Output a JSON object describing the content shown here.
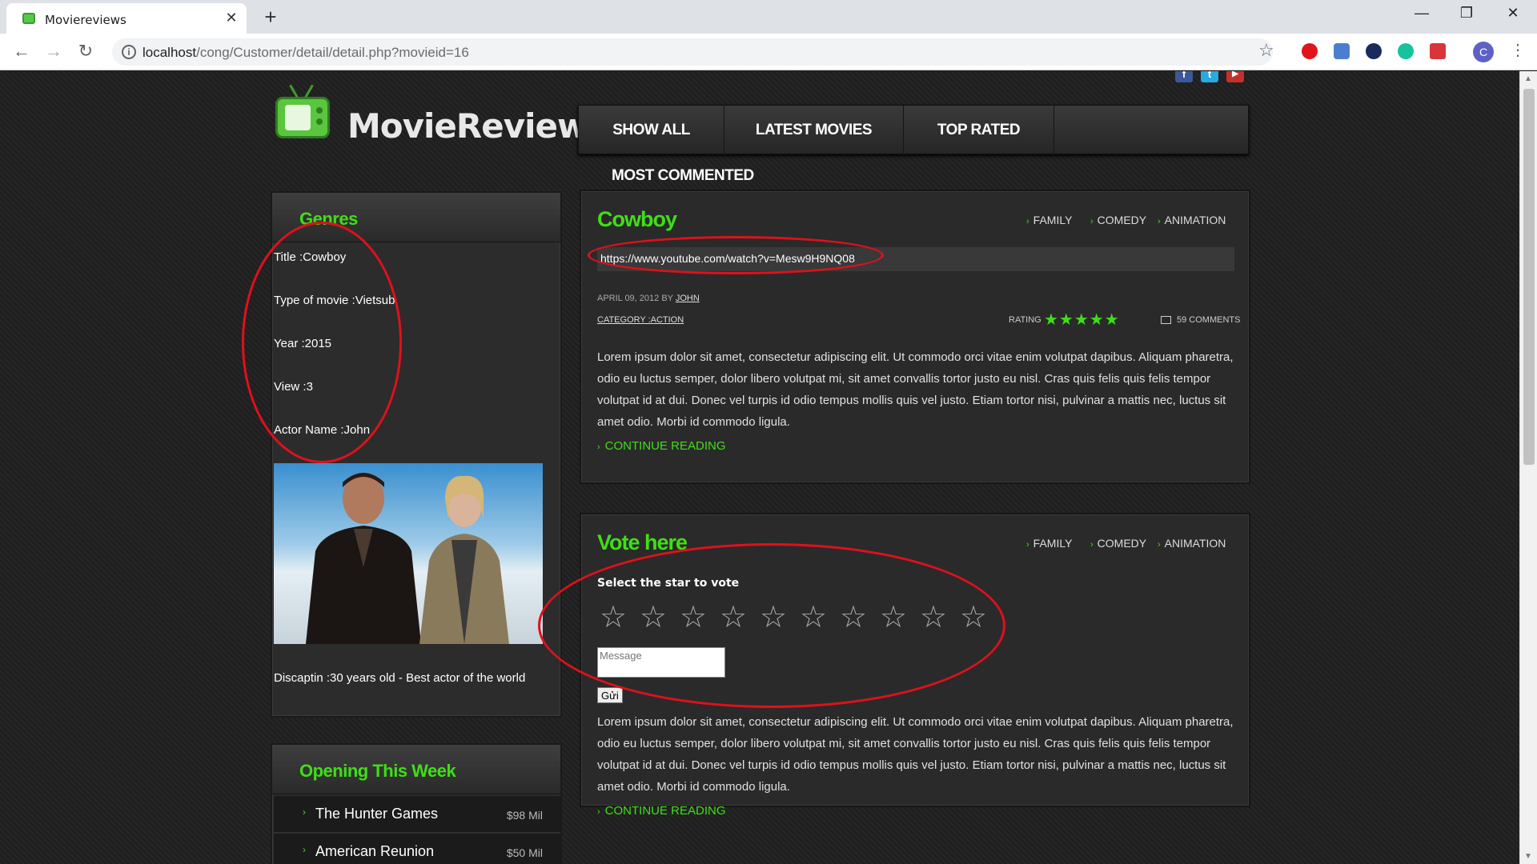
{
  "browser": {
    "tab_title": "Moviereviews",
    "tab_close": "✕",
    "new_tab": "+",
    "url_host": "localhost",
    "url_path": "/cong/Customer/detail/detail.php?movieid=16",
    "profile_initial": "C",
    "window_controls": [
      "—",
      "❐",
      "✕"
    ]
  },
  "site": {
    "logo_text": "MovieReviews",
    "nav": [
      "SHOW ALL",
      "LATEST MOVIES",
      "TOP RATED"
    ],
    "nav_second_row": "MOST COMMENTED",
    "social": [
      {
        "icon": "facebook-icon",
        "glyph": "f",
        "color": "#3b5998"
      },
      {
        "icon": "twitter-icon",
        "glyph": "t",
        "color": "#2aa9e0"
      },
      {
        "icon": "youtube-icon",
        "glyph": "▶",
        "color": "#c4302b"
      }
    ]
  },
  "sidebar": {
    "genres_title": "Genres",
    "info": [
      "Title :Cowboy",
      "Type of movie :Vietsub",
      "Year :2015",
      "View :3",
      "Actor Name :John"
    ],
    "description": "Discaptin :30 years old - Best actor of the world",
    "opening_title": "Opening This Week",
    "opening": [
      {
        "name": "The Hunter Games",
        "gross": "$98 Mil"
      },
      {
        "name": "American Reunion",
        "gross": "$50 Mil"
      }
    ]
  },
  "post1": {
    "title": "Cowboy",
    "tags": [
      "FAMILY",
      "COMEDY",
      "ANIMATION"
    ],
    "video_url": "https://www.youtube.com/watch?v=Mesw9H9NQ08",
    "date_by": "APRIL 09, 2012 BY",
    "author": "JOHN",
    "category": "CATEGORY :ACTION",
    "rating_label": "RATING",
    "rating_stars": "★★★★★",
    "comments": "59 COMMENTS",
    "body": "Lorem ipsum dolor sit amet, consectetur adipiscing elit. Ut commodo orci vitae enim volutpat dapibus. Aliquam pharetra, odio eu luctus semper, dolor libero volutpat mi, sit amet convallis tortor justo eu nisl. Cras quis felis quis felis tempor volutpat id at dui. Donec vel turpis id odio tempus mollis quis vel justo. Etiam tortor nisi, pulvinar a mattis nec, luctus sit amet odio. Morbi id commodo ligula.",
    "continue": "CONTINUE READING"
  },
  "post2": {
    "title": "Vote here",
    "tags": [
      "FAMILY",
      "COMEDY",
      "ANIMATION"
    ],
    "vote_label": "Select the star to vote",
    "star_glyph": "☆",
    "star_count": 10,
    "message_placeholder": "Message",
    "send_label": "Gửi",
    "body": "Lorem ipsum dolor sit amet, consectetur adipiscing elit. Ut commodo orci vitae enim volutpat dapibus. Aliquam pharetra, odio eu luctus semper, dolor libero volutpat mi, sit amet convallis tortor justo eu nisl. Cras quis felis quis felis tempor volutpat id at dui. Donec vel turpis id odio tempus mollis quis vel justo. Etiam tortor nisi, pulvinar a mattis nec, luctus sit amet odio. Morbi id commodo ligula.",
    "continue": "CONTINUE READING"
  },
  "colors": {
    "accent_green": "#3fdf16",
    "annotation_red": "#e0101c"
  }
}
